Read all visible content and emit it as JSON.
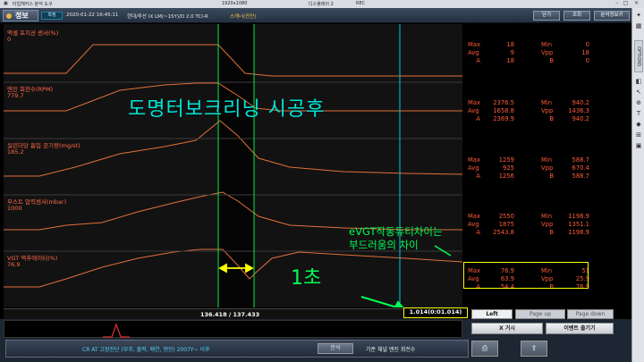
{
  "window": {
    "title": "타입헤커스 분석 도구",
    "resolution": "1920x1080",
    "tab_name": "디스플레이 2",
    "rec_label": "REC"
  },
  "header": {
    "tab_label": "정보",
    "badge": "측정",
    "datetime": "2020-01-22 16:45:11",
    "vehicle": "현대/투산 IX LM(~15Y)/D 2.0 TCI-R",
    "sub": "스캐너(진단)",
    "buttons": [
      "닫기",
      "조회",
      "분석정보키"
    ]
  },
  "right_toolbar": {
    "options_label": "OPTIONS"
  },
  "graph": {
    "channels": [
      {
        "label": "액셀 포지션 센서(%)",
        "value": "0"
      },
      {
        "label": "엔진 회전수(RPM)",
        "value": "779.7"
      },
      {
        "label": "실린더당 흡입 공기량(mg/st)",
        "value": "185.2"
      },
      {
        "label": "부스트 압력센서(mbar)",
        "value": "1000"
      },
      {
        "label": "VGT 액추에이터(%)",
        "value": "76.9"
      }
    ],
    "stats": [
      {
        "max": "18",
        "min": "0",
        "avg": "9",
        "vpp": "18",
        "a": "18",
        "b": "0"
      },
      {
        "max": "2376.5",
        "min": "940.2",
        "avg": "1658.8",
        "vpp": "1436.3",
        "a": "2369.9",
        "b": "940.2"
      },
      {
        "max": "1259",
        "min": "588.7",
        "avg": "925",
        "vpp": "670.4",
        "a": "1256",
        "b": "588.7"
      },
      {
        "max": "2550",
        "min": "1198.9",
        "avg": "1875",
        "vpp": "1351.1",
        "a": "2543.8",
        "b": "1198.9"
      },
      {
        "max": "76.9",
        "min": "51",
        "avg": "63.9",
        "vpp": "25.9",
        "a": "54.4",
        "b": "76.9"
      }
    ],
    "stat_keys": {
      "max": "Max",
      "min": "Min",
      "avg": "Avg",
      "vpp": "Vpp",
      "a": "A",
      "b": "B"
    },
    "position": "136.418 / 137.433",
    "time_readout": "1.014(0:01.014)",
    "page_buttons": [
      "Left",
      "Page up",
      "Page down"
    ]
  },
  "overlay": {
    "title": "도명터보크리닝 시공후",
    "diff_line1": "eVGT작동듀티차이는",
    "diff_line2": "부드러움의 차이",
    "seconds": "1초"
  },
  "bottom": {
    "code_title": "CR AT 고장진단 (부주, 출력, 매연, 엔진) 2007Y~ 이후",
    "code_button": "분석",
    "reference_label": "기준 채널 엔진 회전수",
    "x_button": "X 거시",
    "event_button": "이벤트 출기기"
  },
  "colors": {
    "trace": "#e0703a",
    "label": "#ff6a4a",
    "cursor_green": "#00ee44",
    "cursor_cyan": "#00c8e8",
    "highlight": "#ffff00",
    "overlay_cyan": "#00e5d8",
    "overlay_green": "#00ff55"
  }
}
